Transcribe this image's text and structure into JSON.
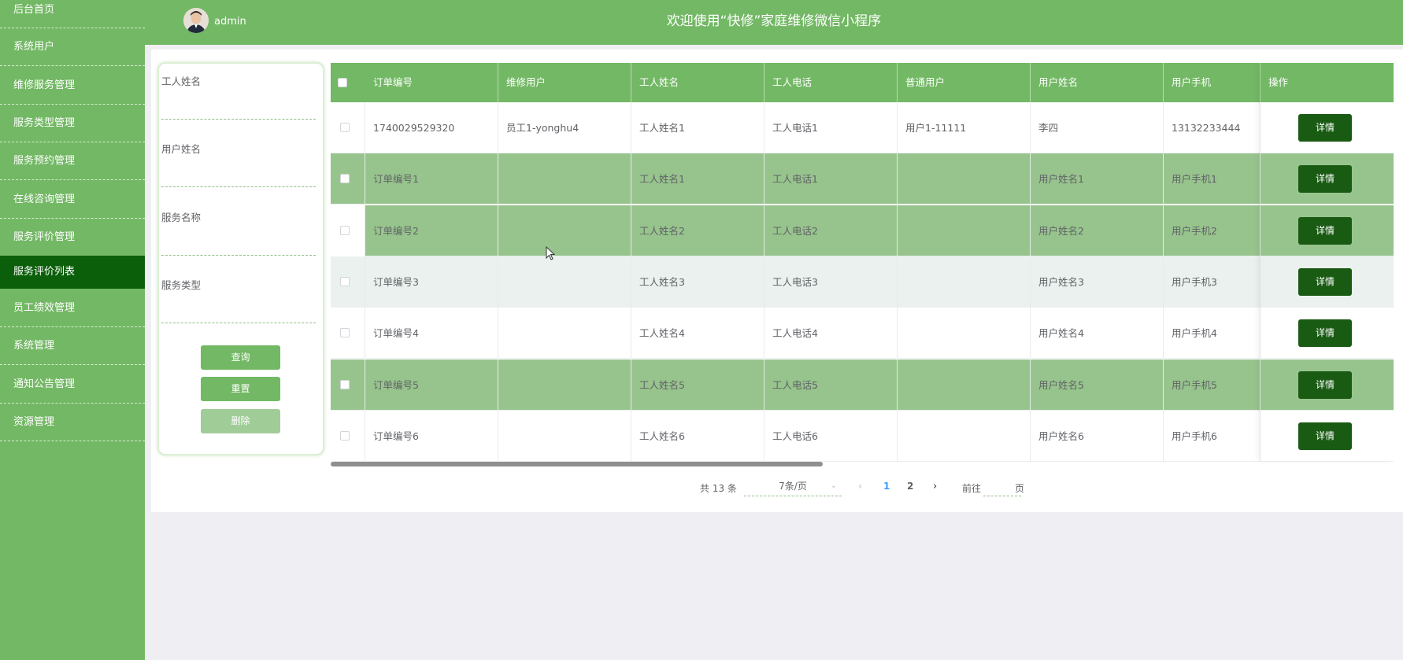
{
  "sidebar": {
    "items": [
      {
        "label": "后台首页"
      },
      {
        "label": "系统用户"
      },
      {
        "label": "维修服务管理"
      },
      {
        "label": "服务类型管理"
      },
      {
        "label": "服务预约管理"
      },
      {
        "label": "在线咨询管理"
      },
      {
        "label": "服务评价管理"
      },
      {
        "label": "服务评价列表"
      },
      {
        "label": "员工绩效管理"
      },
      {
        "label": "系统管理"
      },
      {
        "label": "通知公告管理"
      },
      {
        "label": "资源管理"
      }
    ],
    "active_index": 7
  },
  "header": {
    "username": "admin",
    "title": "欢迎使用“快修”家庭维修微信小程序"
  },
  "search": {
    "fields": [
      {
        "label": "工人姓名",
        "value": ""
      },
      {
        "label": "用户姓名",
        "value": ""
      },
      {
        "label": "服务名称",
        "value": ""
      },
      {
        "label": "服务类型",
        "value": ""
      }
    ],
    "query_label": "查询",
    "reset_label": "重置",
    "delete_label": "删除"
  },
  "table": {
    "columns": [
      "订单编号",
      "维修用户",
      "工人姓名",
      "工人电话",
      "普通用户",
      "用户姓名",
      "用户手机",
      "操作"
    ],
    "detail_label": "详情",
    "rows": [
      {
        "order": "1740029529320",
        "repair_user": "员工1-yonghu4",
        "worker": "工人姓名1",
        "phone": "工人电话1",
        "user": "用户1-11111",
        "user_name": "李四",
        "mobile": "13132233444"
      },
      {
        "order": "订单编号1",
        "repair_user": "",
        "worker": "工人姓名1",
        "phone": "工人电话1",
        "user": "",
        "user_name": "用户姓名1",
        "mobile": "用户手机1"
      },
      {
        "order": "订单编号2",
        "repair_user": "",
        "worker": "工人姓名2",
        "phone": "工人电话2",
        "user": "",
        "user_name": "用户姓名2",
        "mobile": "用户手机2"
      },
      {
        "order": "订单编号3",
        "repair_user": "",
        "worker": "工人姓名3",
        "phone": "工人电话3",
        "user": "",
        "user_name": "用户姓名3",
        "mobile": "用户手机3"
      },
      {
        "order": "订单编号4",
        "repair_user": "",
        "worker": "工人姓名4",
        "phone": "工人电话4",
        "user": "",
        "user_name": "用户姓名4",
        "mobile": "用户手机4"
      },
      {
        "order": "订单编号5",
        "repair_user": "",
        "worker": "工人姓名5",
        "phone": "工人电话5",
        "user": "",
        "user_name": "用户姓名5",
        "mobile": "用户手机5"
      },
      {
        "order": "订单编号6",
        "repair_user": "",
        "worker": "工人姓名6",
        "phone": "工人电话6",
        "user": "",
        "user_name": "用户姓名6",
        "mobile": "用户手机6"
      }
    ],
    "row_styles": [
      "white",
      "green",
      "green",
      "hover",
      "white",
      "green",
      "white"
    ]
  },
  "pagination": {
    "total": "共 13 条",
    "page_size": "7条/页",
    "pages": [
      "1",
      "2"
    ],
    "current_page": "1",
    "goto_label": "前往",
    "page_label": "页"
  },
  "colors": {
    "primary": "#73b865",
    "sidebar_active": "#0b5f0b",
    "detail_button": "#1a5b14",
    "row_highlight": "#97c48d"
  }
}
